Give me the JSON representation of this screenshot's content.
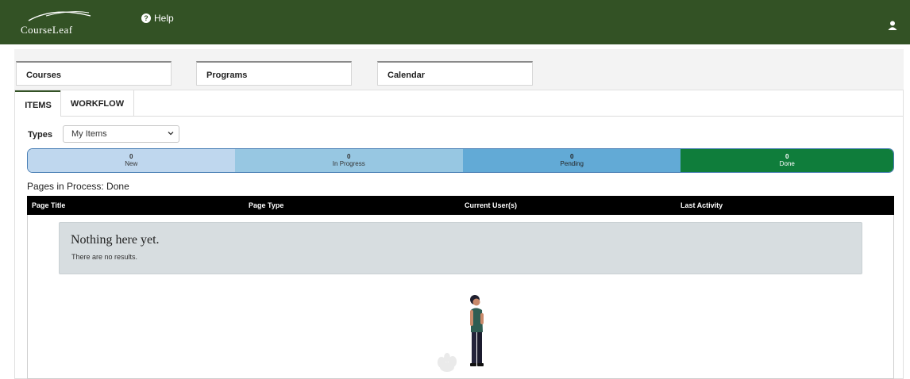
{
  "header": {
    "logo_text": "CourseLeaf",
    "help_label": "Help"
  },
  "top_tabs": [
    {
      "label": "Courses"
    },
    {
      "label": "Programs"
    },
    {
      "label": "Calendar"
    }
  ],
  "sub_tabs": [
    {
      "label": "ITEMS"
    },
    {
      "label": "WORKFLOW"
    }
  ],
  "filters": {
    "types_label": "Types",
    "types_value": "My Items"
  },
  "status": [
    {
      "count": "0",
      "label": "New"
    },
    {
      "count": "0",
      "label": "In Progress"
    },
    {
      "count": "0",
      "label": "Pending"
    },
    {
      "count": "0",
      "label": "Done"
    }
  ],
  "section_title": "Pages in Process: Done",
  "table": {
    "columns": [
      "Page Title",
      "Page Type",
      "Current User(s)",
      "Last Activity"
    ]
  },
  "empty_state": {
    "title": "Nothing here yet.",
    "message": "There are no results."
  },
  "colors": {
    "header_bg": "#335225",
    "new": "#bfd7ee",
    "in_progress": "#97c7e2",
    "pending": "#62aad6",
    "done": "#0f7d3b"
  },
  "icons": {
    "help": "help-circle-icon",
    "user": "user-icon",
    "select": "chevron-down-icon"
  }
}
